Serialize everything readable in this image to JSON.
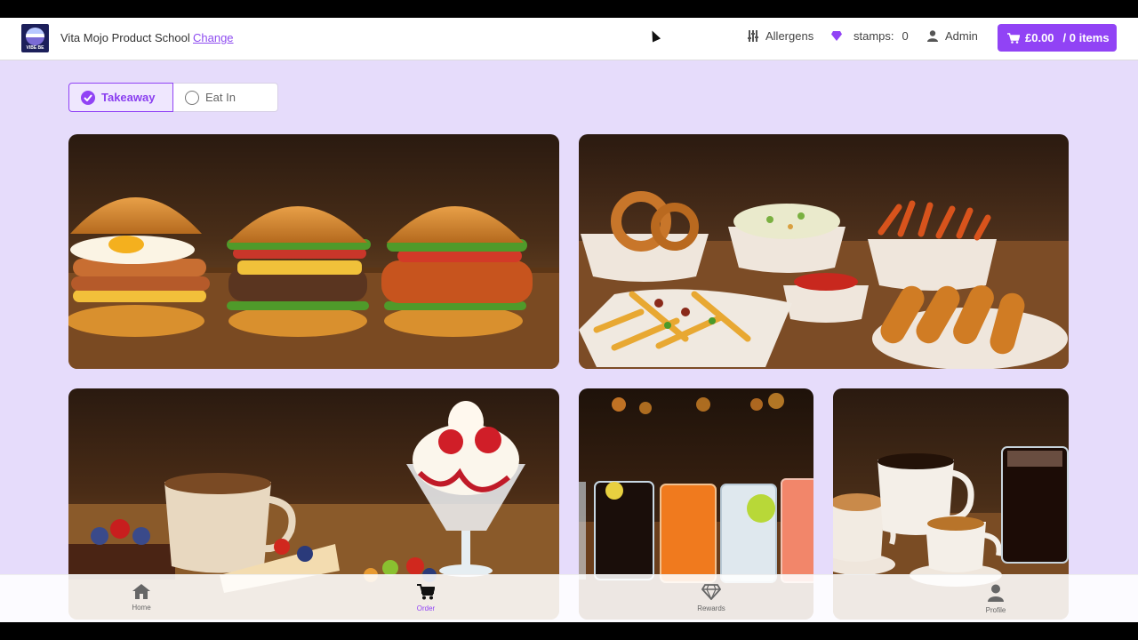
{
  "header": {
    "logo_text": "VIBE BE",
    "store_name": "Vita Mojo Product School",
    "change_label": "Change",
    "allergens_label": "Allergens",
    "stamps_label": "stamps:",
    "stamps_count": "0",
    "user_label": "Admin",
    "cart_total": "£0.00",
    "cart_items": "/ 0 items"
  },
  "order_mode": {
    "selected": "Takeaway",
    "options": [
      "Takeaway",
      "Eat In"
    ]
  },
  "menu_tiles": [
    {
      "image": "burgers"
    },
    {
      "image": "sides"
    },
    {
      "image": "desserts"
    },
    {
      "image": "cold-drinks"
    },
    {
      "image": "hot-drinks"
    }
  ],
  "bottom_nav": [
    {
      "label": "Home",
      "icon": "home-icon"
    },
    {
      "label": "Order",
      "icon": "cart-icon",
      "active": true
    },
    {
      "label": "Rewards",
      "icon": "diamond-icon"
    },
    {
      "label": "Profile",
      "icon": "person-icon"
    }
  ],
  "colors": {
    "accent": "#9143f5",
    "background": "#e6dcfb"
  }
}
